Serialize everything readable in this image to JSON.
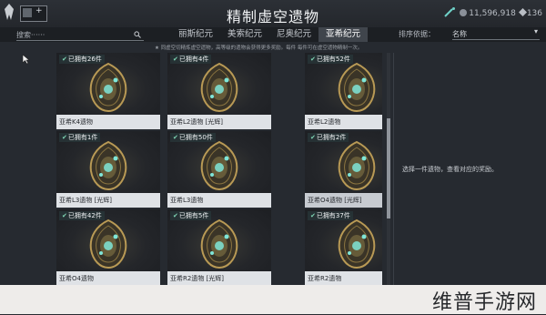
{
  "header": {
    "title": "精制虚空遗物",
    "profile_plus": "+",
    "credits": "11,596,918",
    "platinum": "136"
  },
  "filter": {
    "search_placeholder": "搜索······",
    "tabs": [
      {
        "label": "丽斯纪元",
        "active": false
      },
      {
        "label": "美索纪元",
        "active": false
      },
      {
        "label": "尼奥纪元",
        "active": false
      },
      {
        "label": "亚希纪元",
        "active": true
      }
    ],
    "sort_label": "排序依据：",
    "sort_value": "名称",
    "hint": "★ 同虚空切精炼虚空遗物，高等级的遗物会获得更多奖励。每件 每件可在虚空遗物精制一次。"
  },
  "relics": [
    {
      "owned": "已拥有26件",
      "name": "亚希K4遗物",
      "selected": false
    },
    {
      "owned": "已拥有4件",
      "name": "亚希L2遗物 [光辉]",
      "selected": false
    },
    {
      "owned": "已拥有52件",
      "name": "亚希L2遗物",
      "selected": false
    },
    {
      "owned": "已拥有1件",
      "name": "亚希L3遗物 [光辉]",
      "selected": false
    },
    {
      "owned": "已拥有50件",
      "name": "亚希L3遗物",
      "selected": false
    },
    {
      "owned": "已拥有2件",
      "name": "亚希O4遗物 [光辉]",
      "selected": true
    },
    {
      "owned": "已拥有42件",
      "name": "亚希O4遗物",
      "selected": false
    },
    {
      "owned": "已拥有5件",
      "name": "亚希R2遗物 [光辉]",
      "selected": false
    },
    {
      "owned": "已拥有37件",
      "name": "亚希R2遗物",
      "selected": false
    }
  ],
  "detail": {
    "text": "选择一件遗物，查看对应的奖励。"
  },
  "watermark": "维普手游网",
  "colors": {
    "background": "#262a30",
    "card_label": "#dfe2e6",
    "relic_gold": "#b99a55",
    "relic_glow": "#7fe6d8"
  }
}
